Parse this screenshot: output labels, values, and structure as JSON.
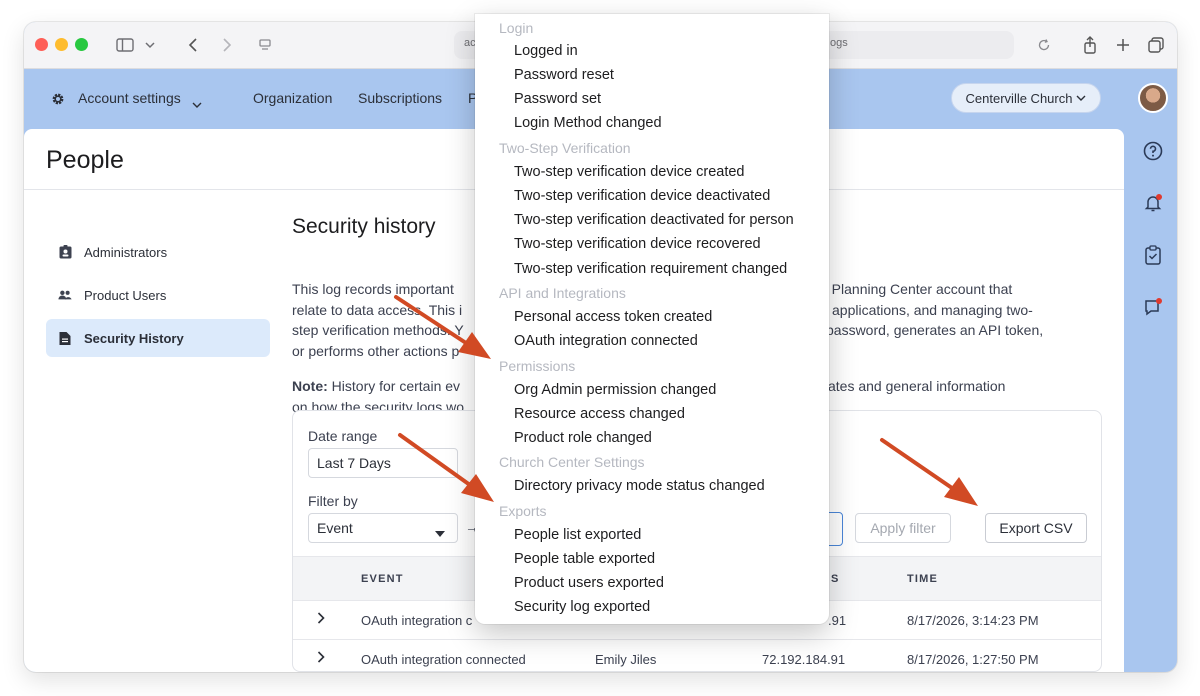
{
  "browser": {
    "url_left": "ac",
    "url_right": "ogs"
  },
  "nav": {
    "settings_label": "Account settings",
    "organization": "Organization",
    "subscriptions": "Subscriptions",
    "partial": "P",
    "church": "Centerville Church"
  },
  "page": {
    "title": "People"
  },
  "sidebar": {
    "items": [
      {
        "label": "Administrators"
      },
      {
        "label": "Product Users"
      },
      {
        "label": "Security History"
      }
    ]
  },
  "content": {
    "title": "Security history",
    "para_lines": [
      {
        "left": "This log records important",
        "right": "h Planning Center account that"
      },
      {
        "left": "relate to data access. This i",
        "right": "applications, and managing two-"
      },
      {
        "left": "step verification methods. Y",
        "right": "password, generates an API token,"
      },
      {
        "left": "or performs other actions p",
        "right": ""
      }
    ],
    "note_label": "Note:",
    "note_line1_left": " History for certain ev",
    "note_line1_right": "ates and general information",
    "note_line2_left": "on how the security logs wo"
  },
  "filters": {
    "date_range_label": "Date range",
    "date_range_value": "Last 7 Days",
    "filter_by_label": "Filter by",
    "filter_by_value": "Event",
    "apply_label": "Apply filter",
    "export_label": "Export CSV"
  },
  "table": {
    "headers": {
      "event": "EVENT",
      "ip": "S",
      "time": "TIME"
    },
    "rows": [
      {
        "event": "OAuth integration c",
        "user": "",
        "ip": ".91",
        "time": "8/17/2026, 3:14:23 PM"
      },
      {
        "event": "OAuth integration connected",
        "user": "Emily Jiles",
        "ip": "72.192.184.91",
        "time": "8/17/2026, 1:27:50 PM"
      }
    ]
  },
  "dropdown": {
    "groups": [
      {
        "label": "Login",
        "items": [
          "Logged in",
          "Password reset",
          "Password set",
          "Login Method changed"
        ]
      },
      {
        "label": "Two-Step Verification",
        "items": [
          "Two-step verification device created",
          "Two-step verification device deactivated",
          "Two-step verification deactivated for person",
          "Two-step verification device recovered",
          "Two-step verification requirement changed"
        ]
      },
      {
        "label": "API and Integrations",
        "items": [
          "Personal access token created",
          "OAuth integration connected"
        ]
      },
      {
        "label": "Permissions",
        "items": [
          "Org Admin permission changed",
          "Resource access changed",
          "Product role changed"
        ]
      },
      {
        "label": "Church Center Settings",
        "items": [
          "Directory privacy mode status changed"
        ]
      },
      {
        "label": "Exports",
        "items": [
          "People list exported",
          "People table exported",
          "Product users exported",
          "Security log exported"
        ]
      }
    ]
  },
  "colors": {
    "accent_bg": "#a9c6ef",
    "annotation_arrow": "#d14a24",
    "active_sidebar": "#dceafb"
  }
}
